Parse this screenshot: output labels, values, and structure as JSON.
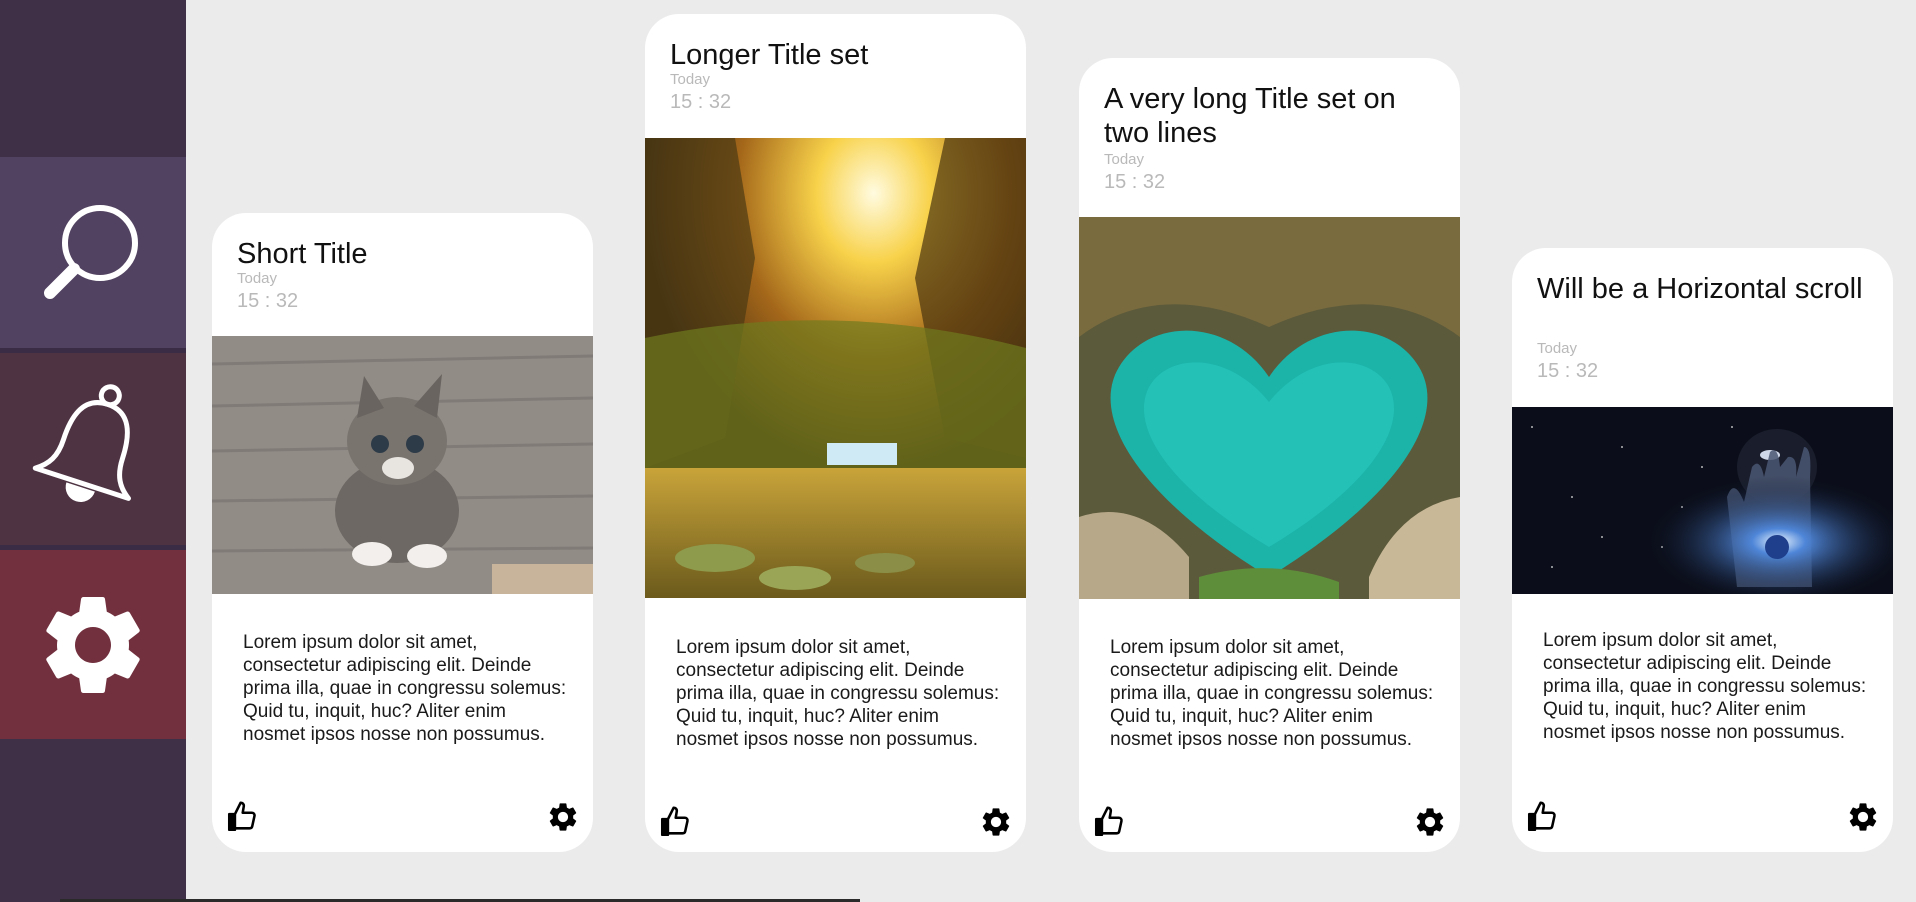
{
  "sidebar": {
    "items": [
      {
        "name": "search",
        "icon": "search-icon"
      },
      {
        "name": "notifications",
        "icon": "bell-icon"
      },
      {
        "name": "settings",
        "icon": "gear-icon"
      }
    ]
  },
  "cards": [
    {
      "title": "Short Title",
      "day": "Today",
      "time": "15 : 32",
      "image": "kitten-photo",
      "body": "Lorem ipsum dolor sit amet, consectetur adipiscing elit. Deinde prima illa, quae in congressu solemus: Quid tu, inquit, huc? Aliter enim nosmet ipsos nosse non possumus.",
      "like_icon": "thumbs-up-icon",
      "settings_icon": "gear-icon"
    },
    {
      "title": "Longer Title set",
      "day": "Today",
      "time": "15 : 32",
      "image": "forest-waterfall-painting",
      "body": "Lorem ipsum dolor sit amet, consectetur adipiscing elit. Deinde prima illa, quae in congressu solemus: Quid tu, inquit, huc? Aliter enim nosmet ipsos nosse non possumus.",
      "like_icon": "thumbs-up-icon",
      "settings_icon": "gear-icon"
    },
    {
      "title": "A very long Title set on two lines",
      "day": "Today",
      "time": "15 : 32",
      "image": "heart-shaped-lagoon",
      "body": "Lorem ipsum dolor sit amet, consectetur adipiscing elit. Deinde prima illa, quae in congressu solemus: Quid tu, inquit, huc? Aliter enim nosmet ipsos nosse non possumus.",
      "like_icon": "thumbs-up-icon",
      "settings_icon": "gear-icon"
    },
    {
      "title": "Will be a Horizontal scroll",
      "day": "Today",
      "time": "15 : 32",
      "image": "space-hand-poster",
      "body": "Lorem ipsum dolor sit amet, consectetur adipiscing elit. Deinde prima illa, quae in congressu solemus: Quid tu, inquit, huc? Aliter enim nosmet ipsos nosse non possumus.",
      "like_icon": "thumbs-up-icon",
      "settings_icon": "gear-icon"
    }
  ],
  "colors": {
    "background": "#ebebeb",
    "sidebar": "#3f3047",
    "sidebar_search": "#524261",
    "sidebar_bell": "#4e3343",
    "sidebar_gear": "#72303e",
    "meta_text": "#b9b9b9"
  }
}
